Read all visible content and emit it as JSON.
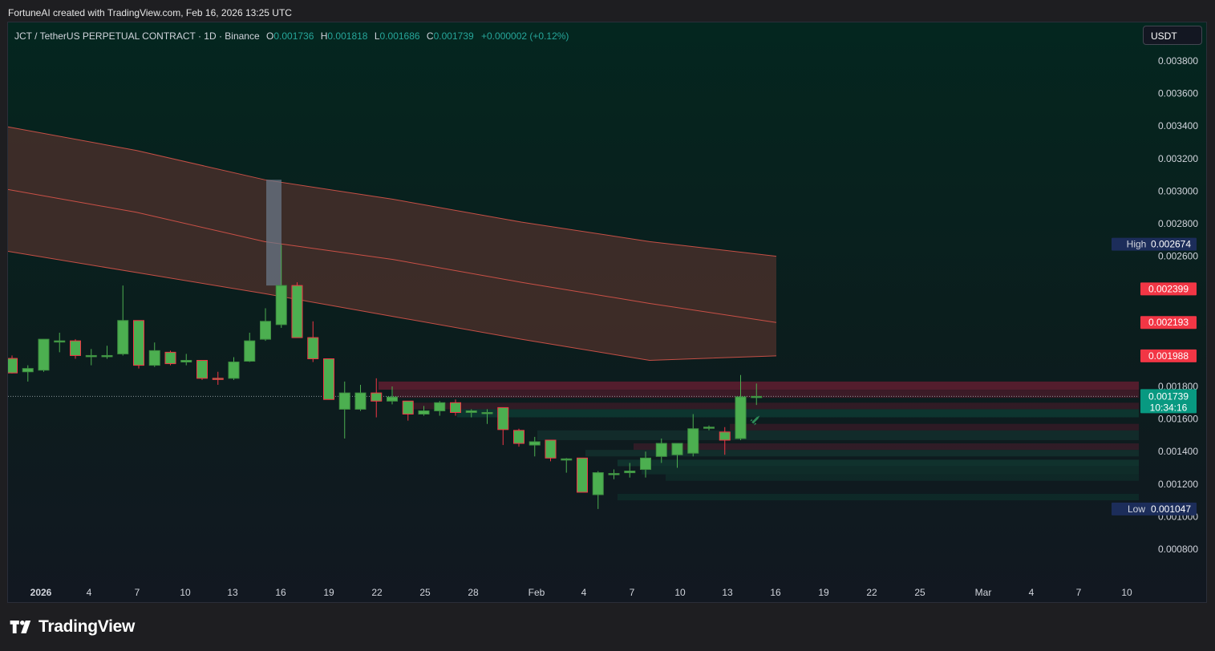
{
  "header": {
    "attribution": "FortuneAI created with TradingView.com, Feb 16, 2026 13:25 UTC"
  },
  "legend": {
    "symbol": "JCT / TetherUS PERPETUAL CONTRACT · 1D · Binance",
    "o_label": "O",
    "o_value": "0.001736",
    "h_label": "H",
    "h_value": "0.001818",
    "l_label": "L",
    "l_value": "0.001686",
    "c_label": "C",
    "c_value": "0.001739",
    "change": "+0.000002 (+0.12%)"
  },
  "currency_button": "USDT",
  "footer": {
    "brand": "TradingView"
  },
  "colors": {
    "up": "#4caf50",
    "down": "#f23645",
    "band_fill": "#4a2f2b",
    "band_line": "#e2574c",
    "price_tag": "#089981",
    "level_tag": "#f23645",
    "high_low_tag": "#1c2d5a"
  },
  "chart_data": {
    "type": "candlestick",
    "ylim": [
      0.0007,
      0.0039
    ],
    "y_ticks": [
      "0.003800",
      "0.003600",
      "0.003400",
      "0.003200",
      "0.003000",
      "0.002800",
      "0.002600",
      "0.001800",
      "0.001600",
      "0.001400",
      "0.001200",
      "0.001000",
      "0.000800"
    ],
    "x_ticks": [
      "2026",
      "4",
      "7",
      "10",
      "13",
      "16",
      "19",
      "22",
      "25",
      "28",
      "Feb",
      "4",
      "7",
      "10",
      "13",
      "16",
      "19",
      "22",
      "25",
      "Mar",
      "4",
      "7",
      "10"
    ],
    "high_label": {
      "text": "High",
      "value": "0.002674"
    },
    "low_label": {
      "text": "Low",
      "value": "0.001047"
    },
    "level_labels": [
      "0.002399",
      "0.002193",
      "0.001988"
    ],
    "last_price": {
      "value": "0.001739",
      "countdown": "10:34:16"
    },
    "candles": [
      {
        "o": 0.001972,
        "h": 0.00199,
        "l": 0.00188,
        "c": 0.001883
      },
      {
        "o": 0.00189,
        "h": 0.00193,
        "l": 0.00183,
        "c": 0.00191
      },
      {
        "o": 0.0019,
        "h": 0.00209,
        "l": 0.00189,
        "c": 0.00209
      },
      {
        "o": 0.00208,
        "h": 0.00213,
        "l": 0.00201,
        "c": 0.00208
      },
      {
        "o": 0.00208,
        "h": 0.00209,
        "l": 0.00197,
        "c": 0.00199
      },
      {
        "o": 0.00199,
        "h": 0.00203,
        "l": 0.00193,
        "c": 0.00199
      },
      {
        "o": 0.00199,
        "h": 0.00205,
        "l": 0.00197,
        "c": 0.00199
      },
      {
        "o": 0.002,
        "h": 0.00242,
        "l": 0.00199,
        "c": 0.002205
      },
      {
        "o": 0.002205,
        "h": 0.002205,
        "l": 0.00191,
        "c": 0.00193
      },
      {
        "o": 0.00193,
        "h": 0.00207,
        "l": 0.00192,
        "c": 0.00202
      },
      {
        "o": 0.00201,
        "h": 0.00202,
        "l": 0.00193,
        "c": 0.00194
      },
      {
        "o": 0.00195,
        "h": 0.002,
        "l": 0.00193,
        "c": 0.00196
      },
      {
        "o": 0.00196,
        "h": 0.00196,
        "l": 0.00184,
        "c": 0.00185
      },
      {
        "o": 0.00185,
        "h": 0.00189,
        "l": 0.00181,
        "c": 0.001845
      },
      {
        "o": 0.00185,
        "h": 0.00198,
        "l": 0.00184,
        "c": 0.00195
      },
      {
        "o": 0.001955,
        "h": 0.00213,
        "l": 0.00195,
        "c": 0.00208
      },
      {
        "o": 0.00209,
        "h": 0.00228,
        "l": 0.00208,
        "c": 0.0022
      },
      {
        "o": 0.00218,
        "h": 0.00267,
        "l": 0.00216,
        "c": 0.00242
      },
      {
        "o": 0.00242,
        "h": 0.00244,
        "l": 0.00215,
        "c": 0.0021
      },
      {
        "o": 0.0021,
        "h": 0.0022,
        "l": 0.00195,
        "c": 0.00197
      },
      {
        "o": 0.00197,
        "h": 0.00197,
        "l": 0.00172,
        "c": 0.00172
      },
      {
        "o": 0.00166,
        "h": 0.00183,
        "l": 0.00148,
        "c": 0.00176
      },
      {
        "o": 0.00166,
        "h": 0.00181,
        "l": 0.00165,
        "c": 0.00176
      },
      {
        "o": 0.00176,
        "h": 0.00185,
        "l": 0.00161,
        "c": 0.00171
      },
      {
        "o": 0.00171,
        "h": 0.0018,
        "l": 0.00169,
        "c": 0.001735
      },
      {
        "o": 0.00171,
        "h": 0.00171,
        "l": 0.00159,
        "c": 0.00163
      },
      {
        "o": 0.00163,
        "h": 0.00168,
        "l": 0.00162,
        "c": 0.00165
      },
      {
        "o": 0.00165,
        "h": 0.00171,
        "l": 0.00162,
        "c": 0.0017
      },
      {
        "o": 0.0017,
        "h": 0.00172,
        "l": 0.00162,
        "c": 0.00164
      },
      {
        "o": 0.00164,
        "h": 0.00166,
        "l": 0.00161,
        "c": 0.00165
      },
      {
        "o": 0.00164,
        "h": 0.00166,
        "l": 0.00157,
        "c": 0.00164
      },
      {
        "o": 0.00167,
        "h": 0.00167,
        "l": 0.00144,
        "c": 0.001535
      },
      {
        "o": 0.00153,
        "h": 0.00154,
        "l": 0.00143,
        "c": 0.00145
      },
      {
        "o": 0.00144,
        "h": 0.00149,
        "l": 0.00137,
        "c": 0.00146
      },
      {
        "o": 0.00147,
        "h": 0.00147,
        "l": 0.00134,
        "c": 0.00136
      },
      {
        "o": 0.00135,
        "h": 0.00136,
        "l": 0.00127,
        "c": 0.001355
      },
      {
        "o": 0.00136,
        "h": 0.00136,
        "l": 0.00115,
        "c": 0.00115
      },
      {
        "o": 0.001135,
        "h": 0.00128,
        "l": 0.001047,
        "c": 0.00127
      },
      {
        "o": 0.001265,
        "h": 0.00129,
        "l": 0.00123,
        "c": 0.001265
      },
      {
        "o": 0.00127,
        "h": 0.00133,
        "l": 0.00124,
        "c": 0.00128
      },
      {
        "o": 0.00129,
        "h": 0.0014,
        "l": 0.00124,
        "c": 0.00136
      },
      {
        "o": 0.00137,
        "h": 0.00148,
        "l": 0.00133,
        "c": 0.00145
      },
      {
        "o": 0.00138,
        "h": 0.00145,
        "l": 0.0013,
        "c": 0.00145
      },
      {
        "o": 0.00139,
        "h": 0.00163,
        "l": 0.00137,
        "c": 0.00154
      },
      {
        "o": 0.00155,
        "h": 0.00156,
        "l": 0.00153,
        "c": 0.00155
      },
      {
        "o": 0.00152,
        "h": 0.00155,
        "l": 0.00138,
        "c": 0.00147
      },
      {
        "o": 0.00148,
        "h": 0.00187,
        "l": 0.00147,
        "c": 0.001736
      },
      {
        "o": 0.001736,
        "h": 0.001818,
        "l": 0.001686,
        "c": 0.001739
      }
    ],
    "bands": {
      "upper": [
        0.003395,
        0.00325,
        0.00307,
        0.00295,
        0.00281,
        0.00269,
        0.0026
      ],
      "middle": [
        0.00301,
        0.00287,
        0.00269,
        0.00258,
        0.00244,
        0.00231,
        0.002193
      ],
      "lower": [
        0.00263,
        0.0025,
        0.00237,
        0.00223,
        0.00209,
        0.00196,
        0.001988
      ]
    }
  }
}
